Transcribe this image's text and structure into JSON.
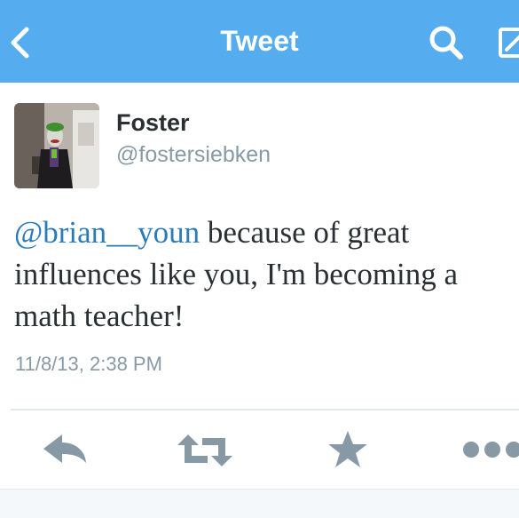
{
  "nav": {
    "title": "Tweet",
    "icons": {
      "back": "chevron-left-icon",
      "search": "search-icon",
      "compose": "compose-icon"
    },
    "colors": {
      "bar": "#55acee",
      "text": "#ffffff"
    }
  },
  "tweet": {
    "author": {
      "name": "Foster",
      "handle": "@fostersiebken"
    },
    "mention": "@brian__youn",
    "text_line1": " because of great",
    "text_line2": "influences like you, I'm becoming a",
    "text_line3": "math teacher!",
    "timestamp": "11/8/13, 2:38 PM"
  },
  "actions": {
    "icons": [
      "reply-icon",
      "retweet-icon",
      "favorite-star-icon",
      "more-dots-icon"
    ],
    "color": "#8899a6"
  },
  "colors": {
    "link": "#2b7bb9",
    "text": "#292f33",
    "muted": "#8899a6",
    "divider": "#e1e8ed"
  }
}
